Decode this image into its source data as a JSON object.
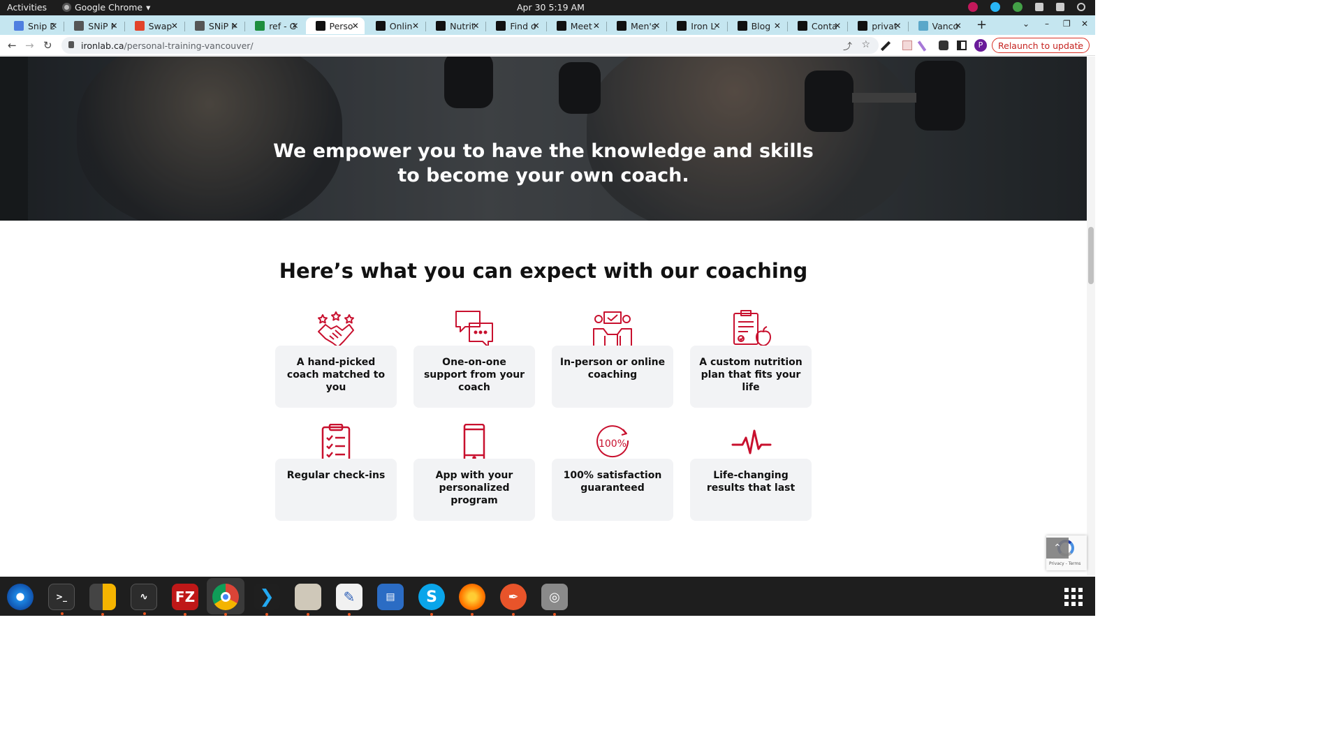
{
  "system_bar": {
    "activities": "Activities",
    "app_name": "Google Chrome",
    "clock": "Apr 30  5:19 AM"
  },
  "tabs": [
    {
      "title": "Snip D",
      "favicon_color": "#4f7fe0"
    },
    {
      "title": "SNiP N",
      "favicon_color": "#555555"
    },
    {
      "title": "Swap",
      "favicon_color": "#e2432a"
    },
    {
      "title": "SNiP N",
      "favicon_color": "#555555"
    },
    {
      "title": "ref - G",
      "favicon_color": "#1e8e3e"
    },
    {
      "title": "Perso",
      "favicon_color": "#111111",
      "active": true
    },
    {
      "title": "Onlin",
      "favicon_color": "#111111"
    },
    {
      "title": "Nutrit",
      "favicon_color": "#111111"
    },
    {
      "title": "Find o",
      "favicon_color": "#111111"
    },
    {
      "title": "Meet",
      "favicon_color": "#111111"
    },
    {
      "title": "Men's",
      "favicon_color": "#111111"
    },
    {
      "title": "Iron L",
      "favicon_color": "#111111"
    },
    {
      "title": "Blog",
      "favicon_color": "#111111"
    },
    {
      "title": "Conta",
      "favicon_color": "#111111"
    },
    {
      "title": "privat",
      "favicon_color": "#111111"
    },
    {
      "title": "Vanco",
      "favicon_color": "#5aa7c9"
    }
  ],
  "toolbar": {
    "url_host": "ironlab.ca",
    "url_path": "/personal-training-vancouver/",
    "profile_initial": "P",
    "relaunch_label": "Relaunch to update"
  },
  "hero": {
    "line1": "We empower you to have the knowledge and skills",
    "line2": "to become your own coach."
  },
  "section": {
    "title": "Here’s what you can expect with our coaching"
  },
  "features": [
    {
      "label": "A hand-picked coach matched to you",
      "icon": "handshake-stars-icon"
    },
    {
      "label": "One-on-one support from your coach",
      "icon": "chat-bubbles-icon"
    },
    {
      "label": "In-person or online coaching",
      "icon": "coach-meeting-icon"
    },
    {
      "label": "A custom nutrition plan that fits your life",
      "icon": "nutrition-plan-icon"
    },
    {
      "label": "Regular check-ins",
      "icon": "checklist-icon"
    },
    {
      "label": "App with your personalized program",
      "icon": "smartphone-icon"
    },
    {
      "label": "100% satisfaction guaranteed",
      "icon": "hundred-percent-icon"
    },
    {
      "label": "Life-changing results that last",
      "icon": "heartbeat-icon"
    }
  ],
  "icon_text": {
    "percent": "100%"
  },
  "recaptcha": {
    "footer": "Privacy - Terms"
  },
  "colors": {
    "accent": "#c8102e",
    "card_bg": "#f2f3f5",
    "tabstrip": "#c5e6f0"
  },
  "dock_apps": [
    "thunderbird-icon",
    "terminal-icon",
    "calculator-icon",
    "system-monitor-icon",
    "filezilla-icon",
    "chrome-icon",
    "vscode-icon",
    "files-icon",
    "text-editor-icon",
    "libreoffice-writer-icon",
    "skype-icon",
    "firefox-dev-icon",
    "inkscape-icon",
    "disk-utility-icon"
  ]
}
